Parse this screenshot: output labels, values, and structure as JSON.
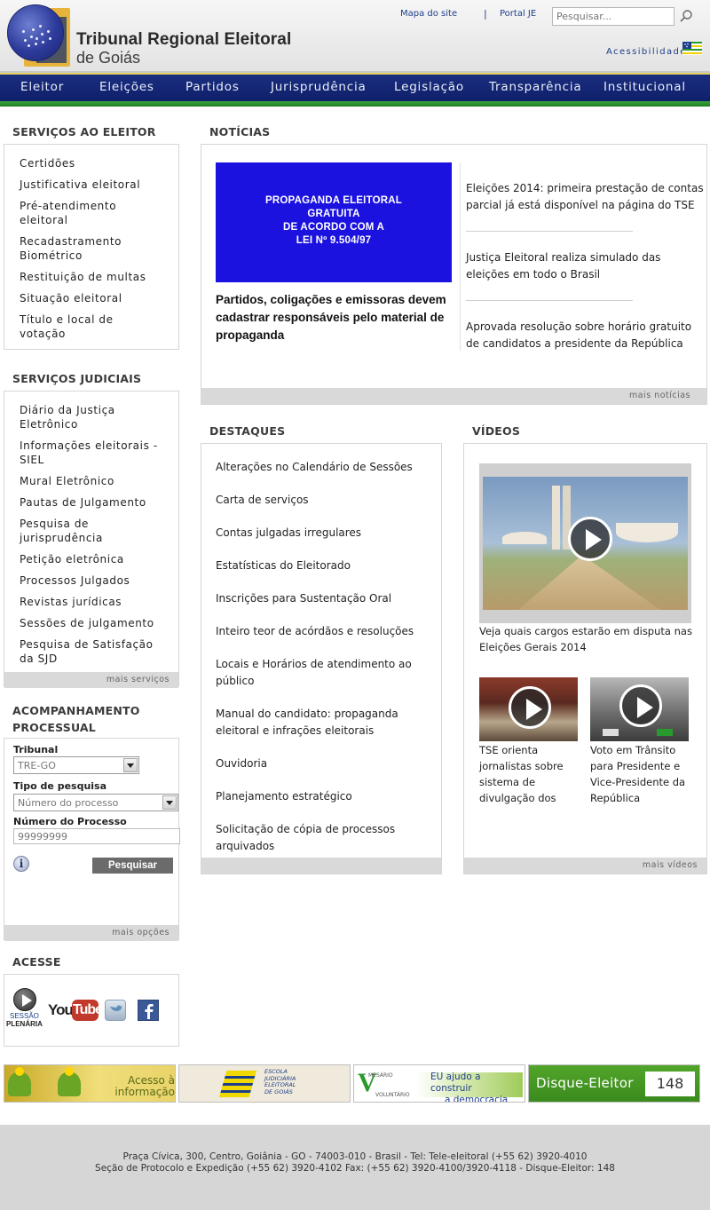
{
  "header": {
    "title_line1": "Tribunal Regional Eleitoral",
    "title_line2": "de Goiás",
    "top_links": {
      "sitemap": "Mapa do site",
      "separator": "|",
      "portal": "Portal JE"
    },
    "search_placeholder": "Pesquisar...",
    "accessibility": "Acessibilidade"
  },
  "nav": {
    "items": [
      "Eleitor",
      "Eleições",
      "Partidos",
      "Jurisprudência",
      "Legislação",
      "Transparência",
      "Institucional"
    ]
  },
  "sidebar": {
    "voter_services": {
      "title": "SERVIÇOS AO ELEITOR",
      "links": [
        "Certidões",
        "Justificativa eleitoral",
        "Pré-atendimento eleitoral",
        "Recadastramento Biométrico",
        "Restituição de multas",
        "Situação eleitoral",
        "Título e local de votação"
      ]
    },
    "judicial_services": {
      "title": "SERVIÇOS JUDICIAIS",
      "links": [
        "Diário da Justiça Eletrônico",
        "Informações eleitorais - SIEL",
        "Mural Eletrônico",
        "Pautas de Julgamento",
        "Pesquisa de jurisprudência",
        "Petição eletrônica",
        "Processos Julgados",
        "Revistas jurídicas",
        "Sessões de julgamento",
        "Pesquisa de Satisfação da SJD"
      ],
      "more": "mais serviços"
    },
    "process_tracking": {
      "title": "ACOMPANHAMENTO PROCESSUAL",
      "tribunal_label": "Tribunal",
      "tribunal_value": "TRE-GO",
      "search_type_label": "Tipo de pesquisa",
      "search_type_value": "Número do processo",
      "process_number_label": "Número do Processo",
      "process_number_placeholder": "99999999",
      "search_button": "Pesquisar",
      "info_icon_text": "i",
      "more": "mais opções"
    },
    "access": {
      "title": "ACESSE",
      "session_label_1": "SESSÃO",
      "session_label_2": "PLENÁRIA",
      "youtube_label_1": "You",
      "youtube_label_2": "Tube"
    }
  },
  "news": {
    "title": "NOTÍCIAS",
    "image_text": [
      "PROPAGANDA ELEITORAL",
      "GRATUITA",
      "DE ACORDO COM A",
      "LEI Nº 9.504/97"
    ],
    "headline": "Partidos, coligações e emissoras devem cadastrar responsáveis pelo material de propaganda",
    "items": [
      "Eleições 2014: primeira prestação de contas parcial já está disponível na página do TSE",
      "Justiça Eleitoral realiza simulado das eleições em todo o Brasil",
      "Aprovada resolução sobre horário gratuito de candidatos a presidente da República"
    ],
    "more": "mais notícias"
  },
  "highlights": {
    "title": "DESTAQUES",
    "links": [
      "Alterações no Calendário de Sessões",
      "Carta de serviços",
      "Contas julgadas irregulares",
      "Estatísticas do Eleitorado",
      "Inscrições para Sustentação Oral",
      "Inteiro teor de acórdãos e resoluções",
      "Locais e Horários de atendimento ao público",
      "Manual do candidato: propaganda eleitoral e infrações eleitorais",
      "Ouvidoria",
      "Planejamento estratégico",
      "Solicitação de cópia de processos arquivados"
    ]
  },
  "videos": {
    "title": "VÍDEOS",
    "main_caption": "Veja quais cargos estarão em disputa nas Eleições Gerais 2014",
    "small": [
      {
        "caption": "TSE orienta jornalistas sobre sistema de divulgação dos"
      },
      {
        "caption": "Voto em Trânsito para Presidente e Vice-Presidente da República"
      }
    ],
    "more": "mais vídeos"
  },
  "banners": {
    "access_info": "Acesso à informação",
    "school_1": "ESCOLA",
    "school_2": "JUDICIÁRIA",
    "school_3": "ELEITORAL",
    "school_4": "DE GOIÁS",
    "volunteer_line1": "EU ajudo a construir",
    "volunteer_line2": "a democracia",
    "volunteer_logo_1": "MESÁRIO",
    "volunteer_logo_2": "VOLUNTÁRIO",
    "hotline_label": "Disque-Eleitor",
    "hotline_number": "148"
  },
  "footer": {
    "line1": "Praça Cívica, 300, Centro, Goiânia - GO - 74003-010 - Brasil - Tel: Tele-eleitoral (+55 62) 3920-4010",
    "line2": "Seção de Protocolo e Expedição (+55 62) 3920-4102 Fax: (+55 62) 3920-4100/3920-4118 - Disque-Eleitor: 148"
  },
  "colors": {
    "nav_blue": "#0d1d66",
    "nav_green": "#2a9a2e",
    "link_blue": "#1d3f8a",
    "news_image_blue": "#1b12e0"
  }
}
